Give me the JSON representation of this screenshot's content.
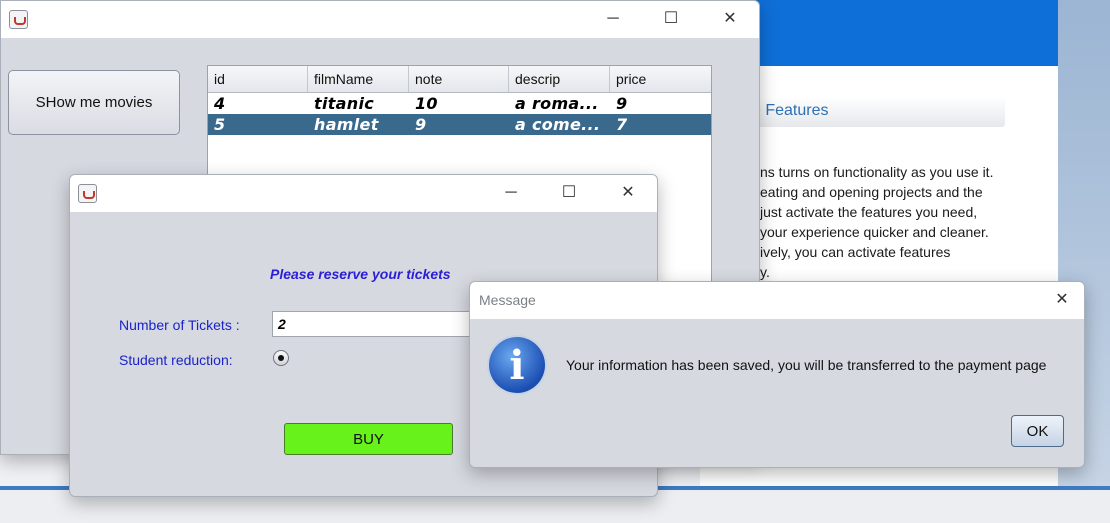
{
  "background": {
    "features_title": "e Features",
    "paragraph": "ns turns on functionality as you use it.\neating and opening projects and the\n just activate the features you need,\n your experience quicker and cleaner.\nively, you can activate features\ny."
  },
  "main_window": {
    "show_button_label": "SHow me movies",
    "columns": [
      "id",
      "filmName",
      "note",
      "descrip",
      "price"
    ],
    "rows": [
      [
        "4",
        "titanic",
        "10",
        "a roma...",
        "9"
      ],
      [
        "5",
        "hamlet",
        "9",
        "a come...",
        "7"
      ]
    ],
    "selected_row": 1
  },
  "reserve_window": {
    "heading": "Please reserve your tickets",
    "tickets_label": "Number of Tickets :",
    "tickets_value": "2",
    "student_label": "Student reduction:",
    "buy_label": "BUY"
  },
  "message_dialog": {
    "title": "Message",
    "icon_glyph": "i",
    "text": "Your information has been saved, you will be transferred to the payment page",
    "ok_label": "OK"
  },
  "window_controls": {
    "minimize": "─",
    "maximize": "☐",
    "close": "✕"
  },
  "colors": {
    "selection": "#396a8e",
    "buy_button": "#66f21a",
    "label_blue": "#1a23c9"
  }
}
